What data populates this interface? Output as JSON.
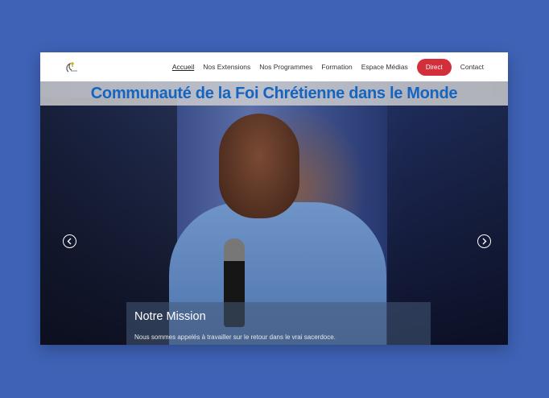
{
  "navbar": {
    "logo_icon": "church-logo-icon",
    "items": [
      {
        "label": "Accueil",
        "active": true
      },
      {
        "label": "Nos Extensions",
        "active": false
      },
      {
        "label": "Nos Programmes",
        "active": false
      },
      {
        "label": "Formation",
        "active": false
      },
      {
        "label": "Espace Médias",
        "active": false
      }
    ],
    "direct_label": "Direct",
    "contact_label": "Contact",
    "direct_color": "#d32f3a"
  },
  "hero": {
    "title": "Communauté de la Foi Chrétienne dans le Monde",
    "title_color": "#1565c0",
    "prev_icon": "chevron-left-icon",
    "next_icon": "chevron-right-icon",
    "caption": {
      "heading": "Notre Mission",
      "text": "Nous sommes appelés à travailler sur le retour dans le vrai sacerdoce."
    }
  },
  "page": {
    "background": "#3f62b6"
  }
}
